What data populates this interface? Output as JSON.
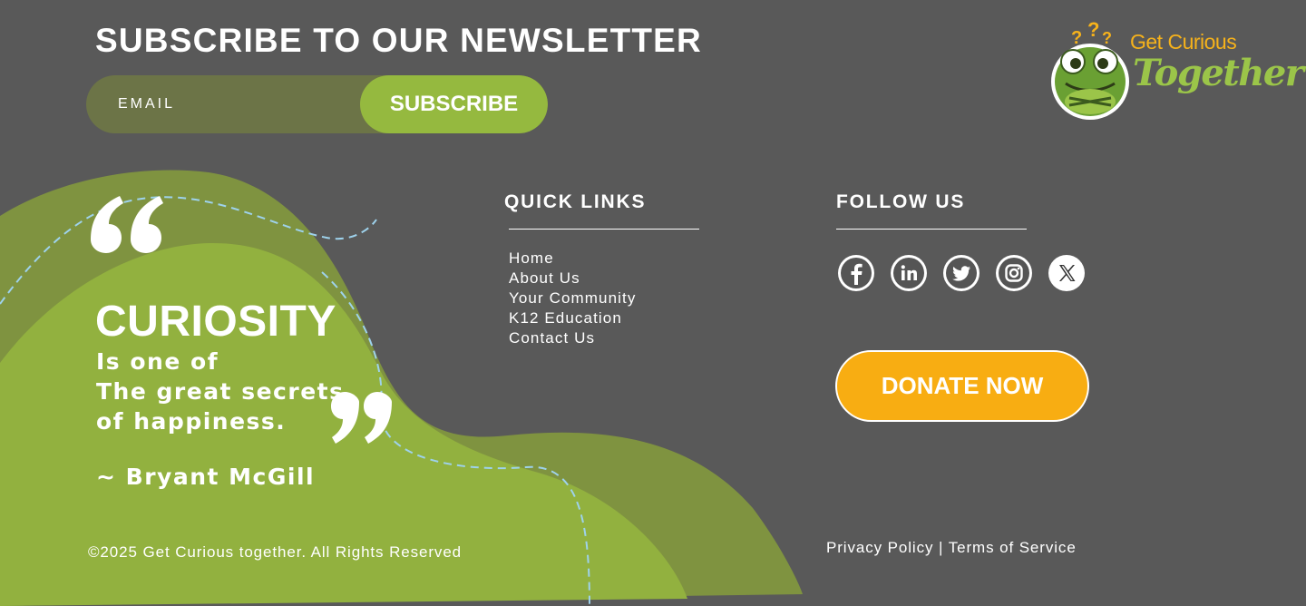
{
  "newsletter": {
    "title": "SUBSCRIBE TO OUR NEWSLETTER",
    "email_placeholder": "EMAIL",
    "subscribe_label": "SUBSCRIBE"
  },
  "logo": {
    "line1": "Get Curious",
    "line2": "Together",
    "mascot_icon": "frog-mascot-icon"
  },
  "quick_links": {
    "title": "QUICK LINKS",
    "items": [
      {
        "label": "Home"
      },
      {
        "label": "About Us"
      },
      {
        "label": "Your Community"
      },
      {
        "label": "K12 Education"
      },
      {
        "label": "Contact Us"
      }
    ]
  },
  "follow_us": {
    "title": "FOLLOW US",
    "icons": [
      "facebook-icon",
      "linkedin-icon",
      "twitter-icon",
      "instagram-icon",
      "x-icon"
    ]
  },
  "donate": {
    "label": "DONATE NOW"
  },
  "quote": {
    "main": "CURIOSITY",
    "line1": "Is one of",
    "line2": "The great secrets",
    "line3": "of happiness.",
    "author": "~ Bryant McGill"
  },
  "footer": {
    "copyright": "©2025 Get Curious together. All Rights Reserved",
    "privacy": "Privacy Policy",
    "separator": "|",
    "terms": "Terms of Service"
  },
  "colors": {
    "background": "#595959",
    "green_light": "#95b93f",
    "green_dark": "#6c7447",
    "orange": "#f8ad12"
  }
}
